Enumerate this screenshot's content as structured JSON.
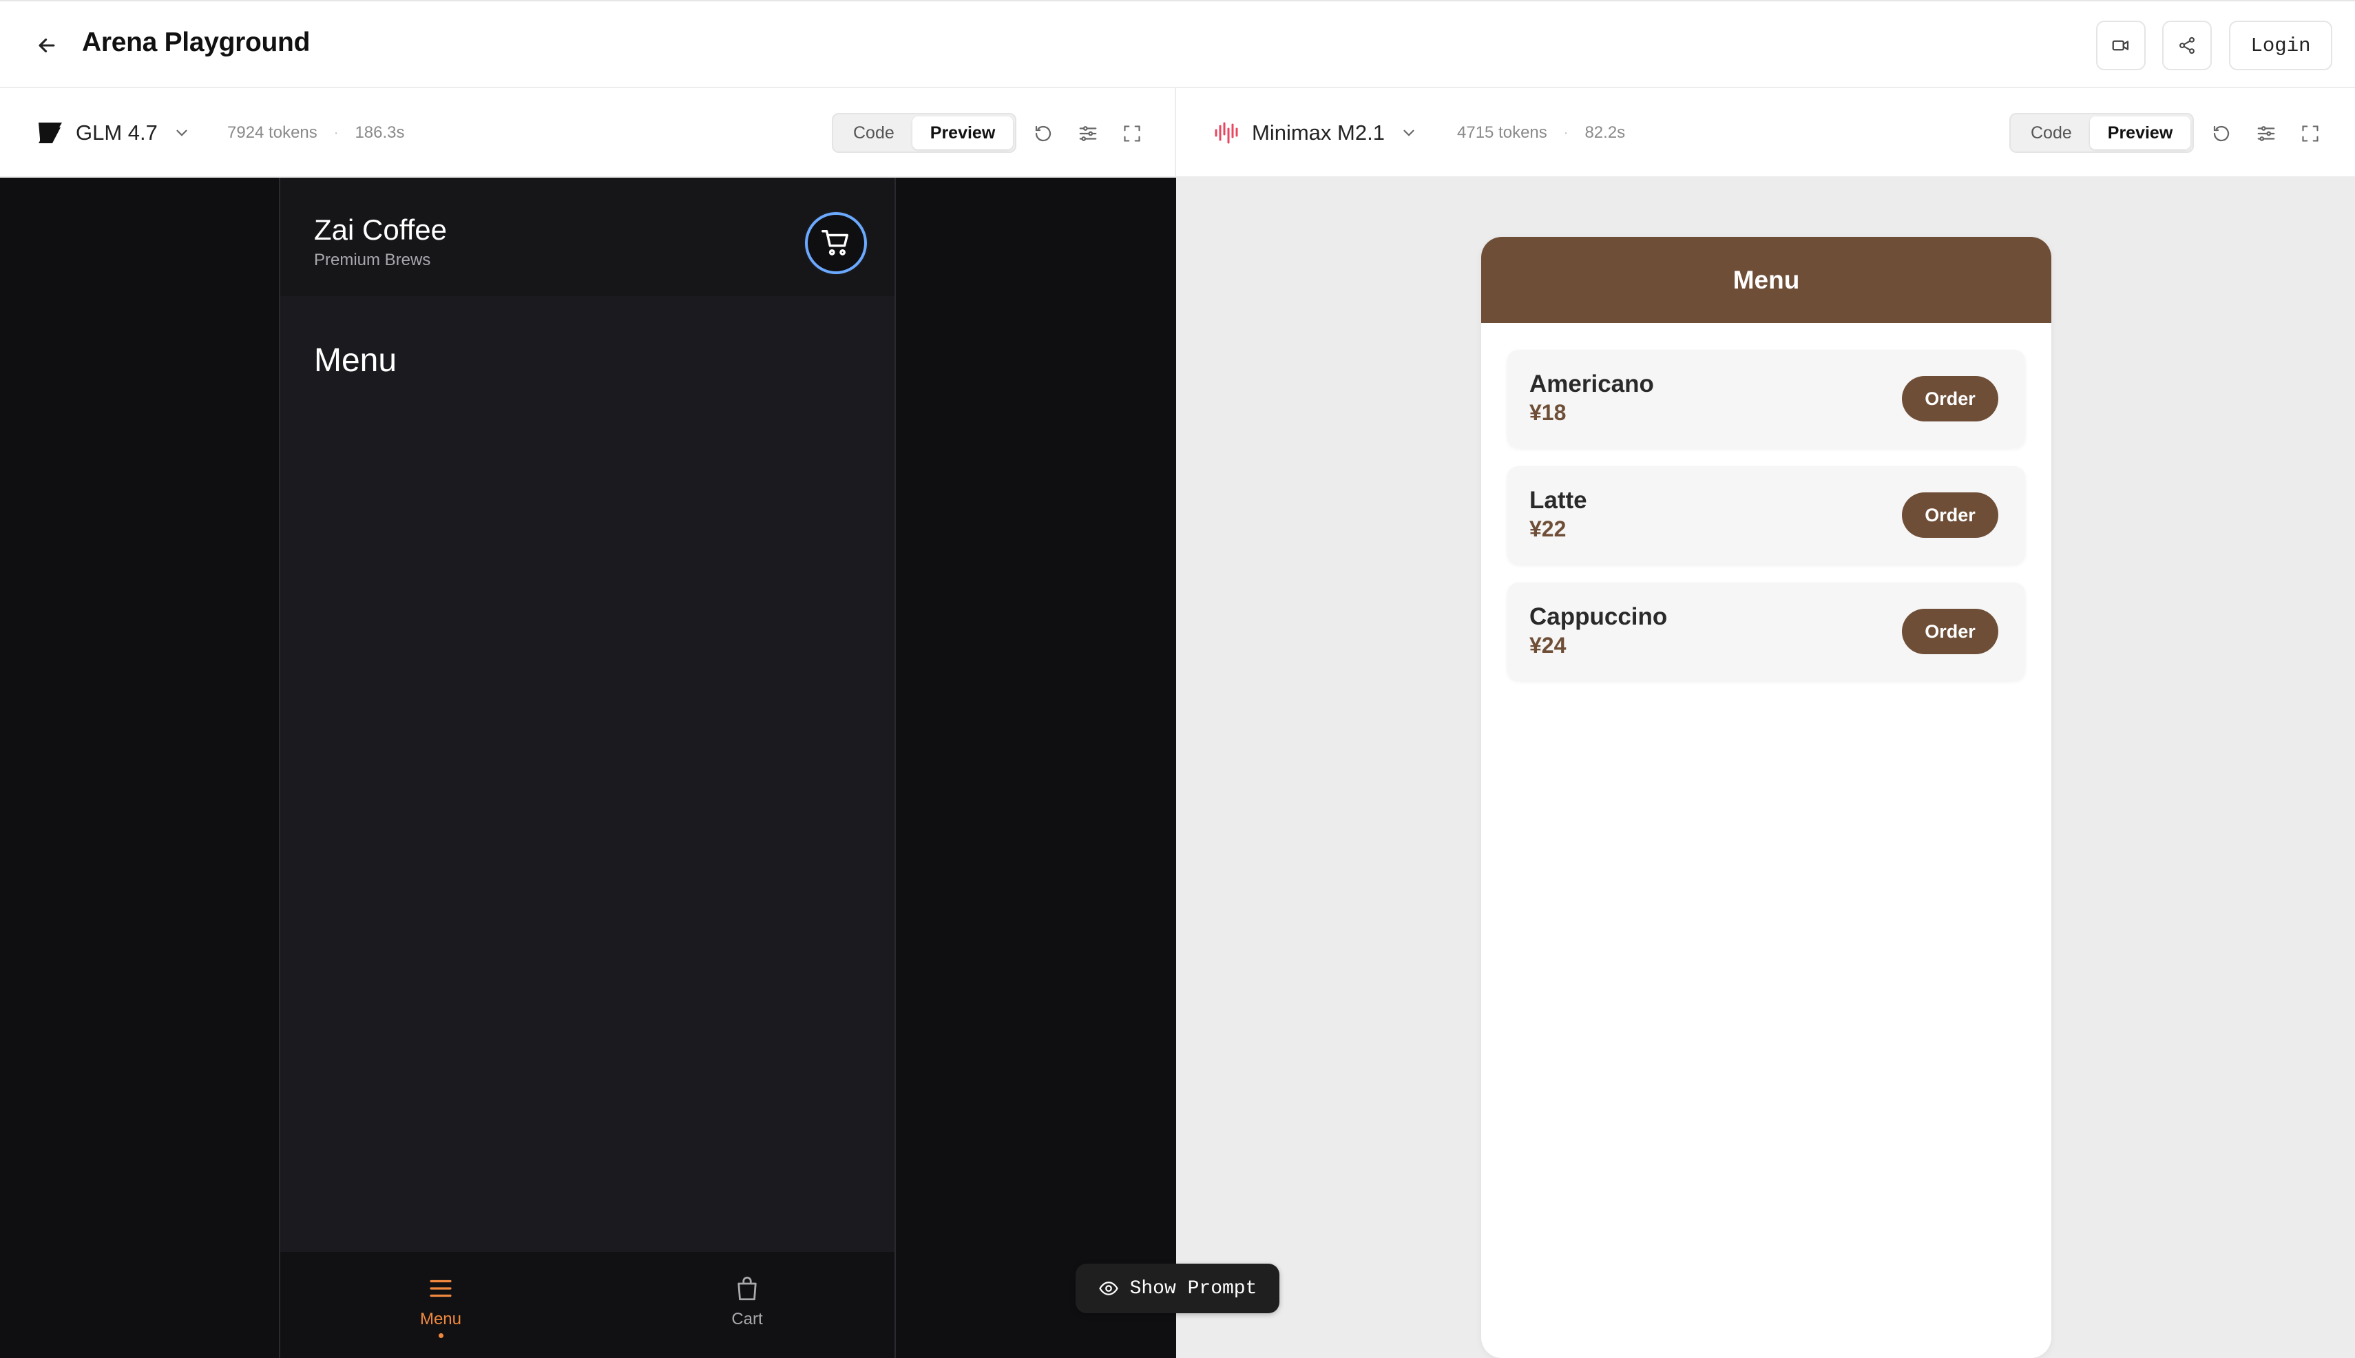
{
  "app": {
    "title": "Arena Playground",
    "login_label": "Login"
  },
  "left_panel": {
    "model_name": "GLM 4.7",
    "tokens": "7924 tokens",
    "time": "186.3s",
    "dot": "·",
    "code_tab": "Code",
    "preview_tab": "Preview",
    "preview": {
      "shop_name": "Zai Coffee",
      "shop_subtitle": "Premium Brews",
      "menu_heading": "Menu",
      "nav": [
        {
          "label": "Menu",
          "active": true,
          "color": "#f0883e"
        },
        {
          "label": "Cart",
          "active": false,
          "color": "#a8a8ad"
        }
      ]
    }
  },
  "right_panel": {
    "model_name": "Minimax M2.1",
    "tokens": "4715 tokens",
    "time": "82.2s",
    "dot": "·",
    "code_tab": "Code",
    "preview_tab": "Preview",
    "preview": {
      "header_title": "Menu",
      "items": [
        {
          "name": "Americano",
          "price": "¥18",
          "button": "Order"
        },
        {
          "name": "Latte",
          "price": "¥22",
          "button": "Order"
        },
        {
          "name": "Cappuccino",
          "price": "¥24",
          "button": "Order"
        }
      ]
    }
  },
  "show_prompt_label": "Show Prompt",
  "colors": {
    "coffee_brown": "#6f4e37",
    "accent_orange": "#f0883e",
    "minimax_red": "#e8475f",
    "cart_ring_blue": "#6ba9ff"
  }
}
